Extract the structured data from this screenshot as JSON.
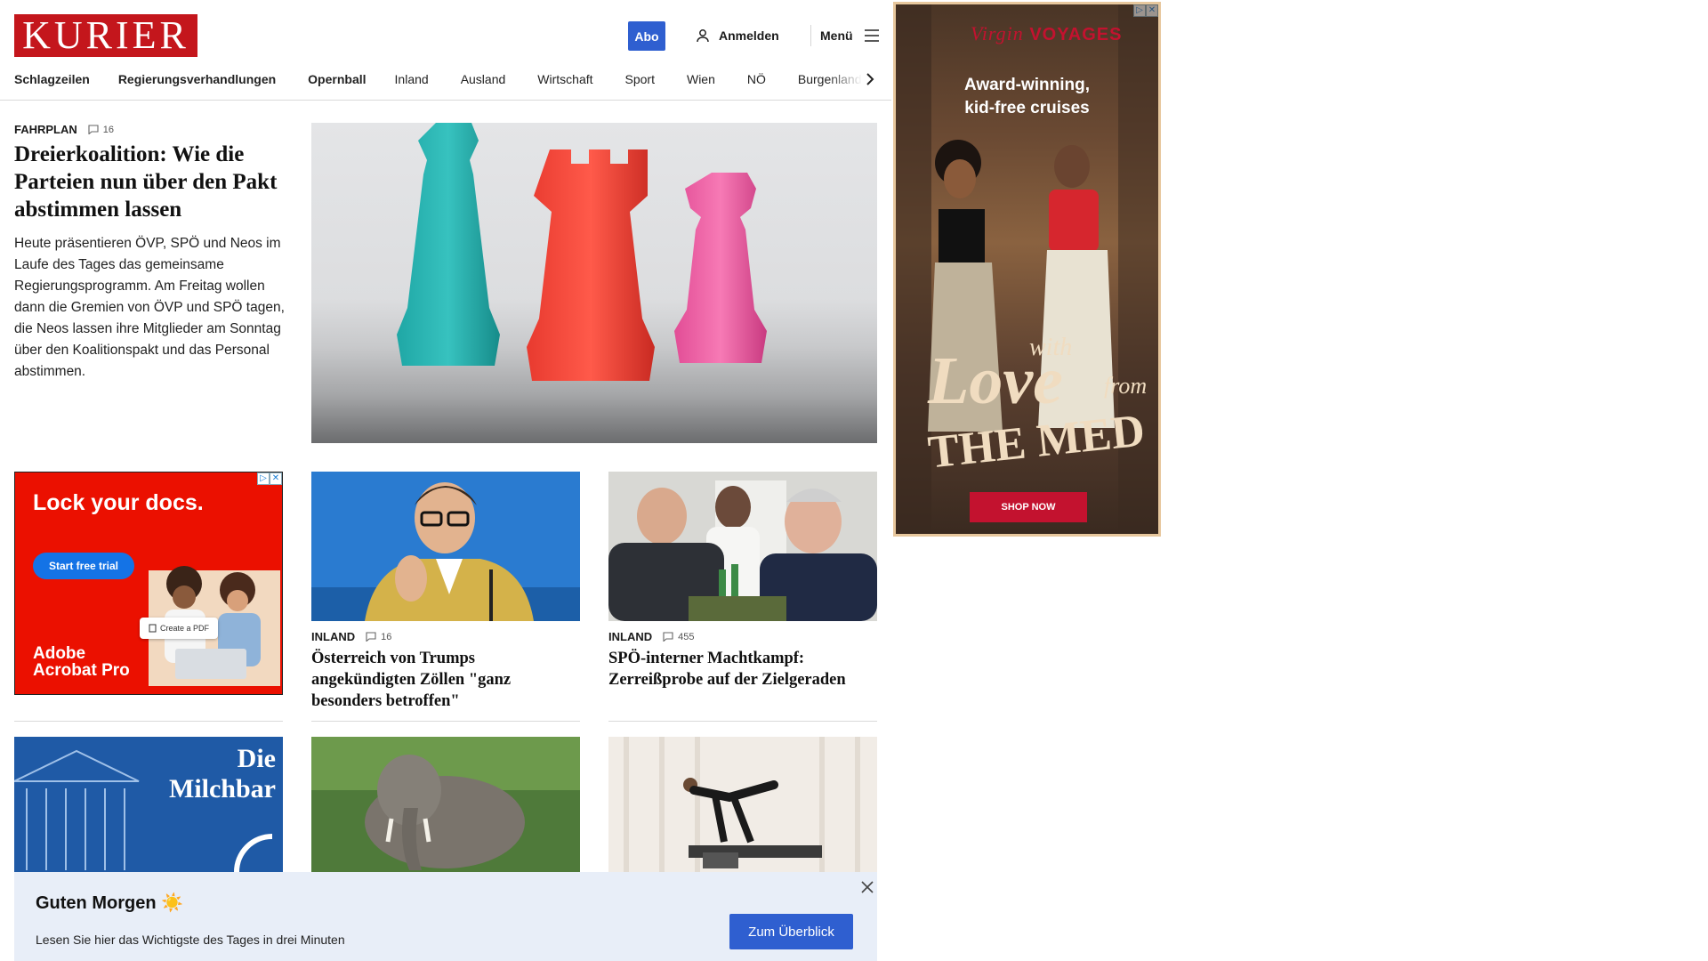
{
  "header": {
    "logo": "KURIER",
    "abo_label": "Abo",
    "login_label": "Anmelden",
    "menu_label": "Menü",
    "accent": "#c4161c",
    "button_color": "#2f5fd0"
  },
  "nav": {
    "items": [
      "Schlagzeilen",
      "Regierungsverhandlungen",
      "Opernball",
      "Inland",
      "Ausland",
      "Wirtschaft",
      "Sport",
      "Wien",
      "NÖ",
      "Burgenland"
    ]
  },
  "lead": {
    "kicker": "FAHRPLAN",
    "comments": "16",
    "title": "Dreierkoalition: Wie die Parteien nun über den Pakt abstimmen lassen",
    "text": "Heute präsentieren ÖVP, SPÖ und Neos im Laufe des Tages das gemeinsame Regierungsprogramm. Am Freitag wollen dann die Gremien von ÖVP und SPÖ tagen, die Neos lassen ihre Mitglieder am Sonntag über den Koalitionspakt und das Personal abstimmen."
  },
  "cards": [
    {
      "kicker": "INLAND",
      "comments": "16",
      "title": "Österreich von Trumps angekündigten Zöllen \"ganz besonders betroffen\""
    },
    {
      "kicker": "INLAND",
      "comments": "455",
      "title": "SPÖ-interner Machtkampf: Zerreißprobe auf der Zielgeraden"
    }
  ],
  "promo_milchbar": {
    "line1": "Die",
    "line2": "Milchbar"
  },
  "ad_adobe": {
    "headline": "Lock your docs.",
    "cta": "Start free trial",
    "chip": "Create a PDF",
    "brand_line1": "Adobe",
    "brand_line2": "Acrobat Pro",
    "icon": "adchoices-icon"
  },
  "ad_virgin": {
    "logo_script": "Virgin",
    "logo_word": "VOYAGES",
    "headline_line1": "Award-winning,",
    "headline_line2": "kid-free cruises",
    "tag_with": "with",
    "tag_love": "Love",
    "tag_from": "from",
    "tag_med": "THE MED",
    "cta": "SHOP NOW"
  },
  "banner": {
    "greeting": "Guten Morgen ☀️",
    "subtitle": "Lesen Sie hier das Wichtigste des Tages in drei Minuten",
    "button": "Zum Überblick"
  }
}
